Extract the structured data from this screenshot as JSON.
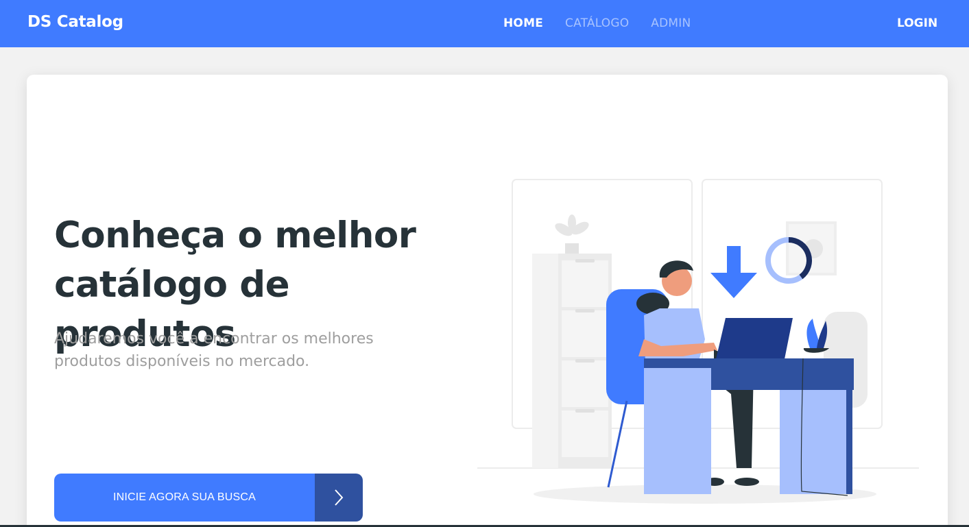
{
  "navbar": {
    "brand": "DS Catalog",
    "links": [
      {
        "label": "HOME",
        "active": true
      },
      {
        "label": "CATÁLOGO",
        "active": false
      },
      {
        "label": "ADMIN",
        "active": false
      }
    ],
    "login": "LOGIN"
  },
  "hero": {
    "title_line1": "Conheça o melhor",
    "title_line2": "catálogo de produtos",
    "subtitle_line1": "Ajudaremos você a encontrar os melhores",
    "subtitle_line2": "produtos disponíveis no mercado.",
    "cta_label": "INICIE AGORA SUA BUSCA",
    "cta_icon": "chevron-right-icon"
  },
  "colors": {
    "primary": "#407bff",
    "primary_dark": "#2f519f",
    "heading": "#263238",
    "muted": "#9e9e9e",
    "background": "#f2f2f2"
  }
}
